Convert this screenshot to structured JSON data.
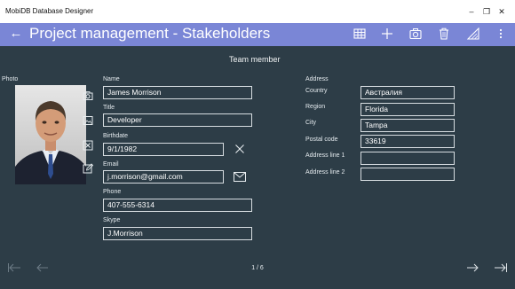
{
  "window": {
    "title": "MobiDB Database Designer",
    "minimize_label": "–",
    "maximize_label": "❐",
    "close_label": "✕"
  },
  "appbar": {
    "title": "Project management - Stakeholders",
    "back_glyph": "←",
    "toolbar_icons": [
      "table-icon",
      "add-icon",
      "camera-icon",
      "delete-icon",
      "chart-icon",
      "more-icon"
    ]
  },
  "form": {
    "section_title": "Team member",
    "photo_label": "Photo",
    "name_label": "Name",
    "name_value": "James Morrison",
    "title_label": "Title",
    "title_value": "Developer",
    "birthdate_label": "Birthdate",
    "birthdate_value": "9/1/1982",
    "email_label": "Email",
    "email_value": "j.morrison@gmail.com",
    "phone_label": "Phone",
    "phone_value": "407-555-6314",
    "skype_label": "Skype",
    "skype_value": "J.Morrison"
  },
  "address": {
    "section_label": "Address",
    "country_label": "Country",
    "country_value": "Австралия",
    "region_label": "Region",
    "region_value": "Florida",
    "city_label": "City",
    "city_value": "Tampa",
    "postal_label": "Postal code",
    "postal_value": "33619",
    "line1_label": "Address line 1",
    "line1_value": "",
    "line2_label": "Address line 2",
    "line2_value": ""
  },
  "footer": {
    "pager": "1 / 6"
  },
  "colors": {
    "background": "#2d3d47",
    "appbar": "#7a86d6",
    "titlebar": "#ffffff"
  }
}
